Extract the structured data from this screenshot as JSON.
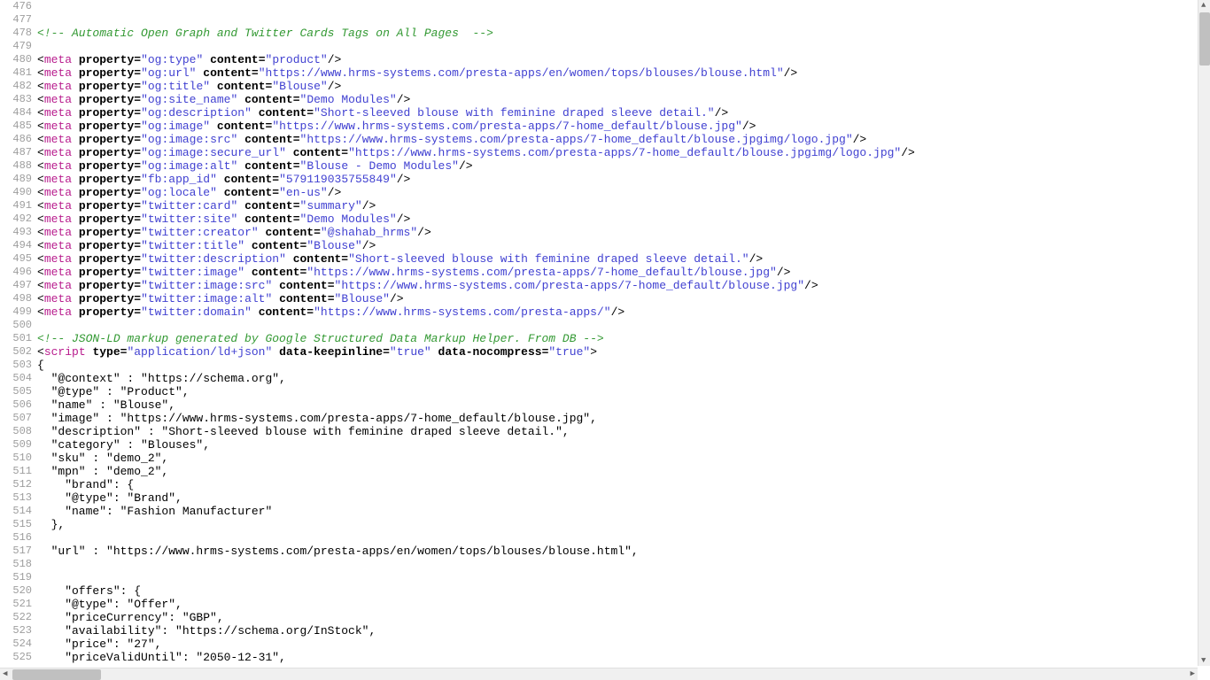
{
  "startLine": 476,
  "lines": [
    {
      "t": "blank"
    },
    {
      "t": "blank"
    },
    {
      "t": "cmt",
      "text": "<!-- Automatic Open Graph and Twitter Cards Tags on All Pages  -->"
    },
    {
      "t": "blank"
    },
    {
      "t": "meta",
      "prop": "og:type",
      "content": "product"
    },
    {
      "t": "meta",
      "prop": "og:url",
      "content": "https://www.hrms-systems.com/presta-apps/en/women/tops/blouses/blouse.html"
    },
    {
      "t": "meta",
      "prop": "og:title",
      "content": "Blouse"
    },
    {
      "t": "meta",
      "prop": "og:site_name",
      "content": "Demo Modules"
    },
    {
      "t": "meta",
      "prop": "og:description",
      "content": "Short-sleeved blouse with feminine draped sleeve detail."
    },
    {
      "t": "meta",
      "prop": "og:image",
      "content": "https://www.hrms-systems.com/presta-apps/7-home_default/blouse.jpg"
    },
    {
      "t": "meta",
      "prop": "og:image:src",
      "content": "https://www.hrms-systems.com/presta-apps/7-home_default/blouse.jpgimg/logo.jpg"
    },
    {
      "t": "meta",
      "prop": "og:image:secure_url",
      "content": "https://www.hrms-systems.com/presta-apps/7-home_default/blouse.jpgimg/logo.jpg"
    },
    {
      "t": "meta",
      "prop": "og:image:alt",
      "content": "Blouse - Demo Modules"
    },
    {
      "t": "meta",
      "prop": "fb:app_id",
      "content": "579119035755849"
    },
    {
      "t": "meta",
      "prop": "og:locale",
      "content": "en-us"
    },
    {
      "t": "meta",
      "prop": "twitter:card",
      "content": "summary"
    },
    {
      "t": "meta",
      "prop": "twitter:site",
      "content": "Demo Modules"
    },
    {
      "t": "meta",
      "prop": "twitter:creator",
      "content": "@shahab_hrms"
    },
    {
      "t": "meta",
      "prop": "twitter:title",
      "content": "Blouse"
    },
    {
      "t": "meta",
      "prop": "twitter:description",
      "content": "Short-sleeved blouse with feminine draped sleeve detail."
    },
    {
      "t": "meta",
      "prop": "twitter:image",
      "content": "https://www.hrms-systems.com/presta-apps/7-home_default/blouse.jpg"
    },
    {
      "t": "meta",
      "prop": "twitter:image:src",
      "content": "https://www.hrms-systems.com/presta-apps/7-home_default/blouse.jpg"
    },
    {
      "t": "meta",
      "prop": "twitter:image:alt",
      "content": "Blouse"
    },
    {
      "t": "meta",
      "prop": "twitter:domain",
      "content": "https://www.hrms-systems.com/presta-apps/"
    },
    {
      "t": "blank"
    },
    {
      "t": "cmt",
      "text": "<!-- JSON-LD markup generated by Google Structured Data Markup Helper. From DB -->"
    },
    {
      "t": "script",
      "typeAttr": "application/ld+json",
      "keep": "true",
      "nocomp": "true"
    },
    {
      "t": "plain",
      "text": "{"
    },
    {
      "t": "plain",
      "text": "  \"@context\" : \"https://schema.org\","
    },
    {
      "t": "plain",
      "text": "  \"@type\" : \"Product\","
    },
    {
      "t": "plain",
      "text": "  \"name\" : \"Blouse\","
    },
    {
      "t": "plain",
      "text": "  \"image\" : \"https://www.hrms-systems.com/presta-apps/7-home_default/blouse.jpg\","
    },
    {
      "t": "plain",
      "text": "  \"description\" : \"Short-sleeved blouse with feminine draped sleeve detail.\","
    },
    {
      "t": "plain",
      "text": "  \"category\" : \"Blouses\","
    },
    {
      "t": "plain",
      "text": "  \"sku\" : \"demo_2\","
    },
    {
      "t": "plain",
      "text": "  \"mpn\" : \"demo_2\","
    },
    {
      "t": "plain",
      "text": "    \"brand\": {"
    },
    {
      "t": "plain",
      "text": "    \"@type\": \"Brand\","
    },
    {
      "t": "plain",
      "text": "    \"name\": \"Fashion Manufacturer\""
    },
    {
      "t": "plain",
      "text": "  },"
    },
    {
      "t": "plain",
      "text": "  "
    },
    {
      "t": "plain",
      "text": "  \"url\" : \"https://www.hrms-systems.com/presta-apps/en/women/tops/blouses/blouse.html\","
    },
    {
      "t": "plain",
      "text": ""
    },
    {
      "t": "plain",
      "text": "  "
    },
    {
      "t": "plain",
      "text": "    \"offers\": {"
    },
    {
      "t": "plain",
      "text": "    \"@type\": \"Offer\","
    },
    {
      "t": "plain",
      "text": "    \"priceCurrency\": \"GBP\","
    },
    {
      "t": "plain",
      "text": "    \"availability\": \"https://schema.org/InStock\","
    },
    {
      "t": "plain",
      "text": "    \"price\": \"27\","
    },
    {
      "t": "plain",
      "text": "    \"priceValidUntil\": \"2050-12-31\","
    }
  ]
}
